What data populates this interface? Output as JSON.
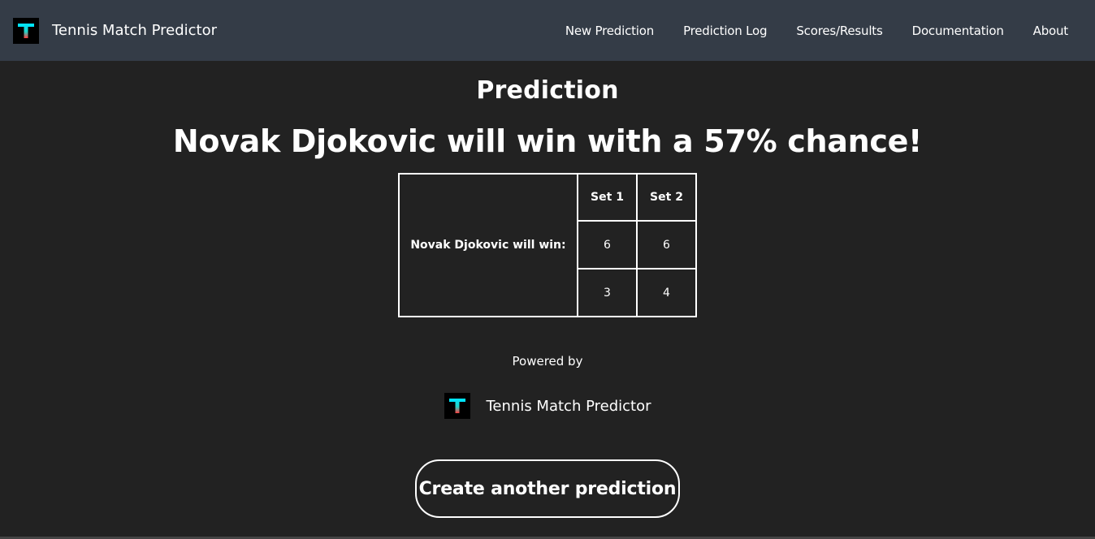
{
  "navbar": {
    "brand": "Tennis Match Predictor",
    "links": [
      "New Prediction",
      "Prediction Log",
      "Scores/Results",
      "Documentation",
      "About"
    ]
  },
  "main": {
    "heading": "Prediction",
    "result": "Novak Djokovic will win with a 57% chance!",
    "table": {
      "headers": [
        "Set 1",
        "Set 2"
      ],
      "row_label": "Novak Djokovic will win:",
      "rows": [
        [
          "6",
          "6"
        ],
        [
          "3",
          "4"
        ]
      ]
    },
    "powered_by": "Powered by",
    "footer_brand": "Tennis Match Predictor",
    "cta_label": "Create another prediction"
  },
  "colors": {
    "background": "#222222",
    "navbar": "#343c47",
    "logo_top": "#00e5ff",
    "logo_bottom": "#ff3d3d"
  },
  "icons": {
    "logo": "tennis-t-logo-icon"
  }
}
